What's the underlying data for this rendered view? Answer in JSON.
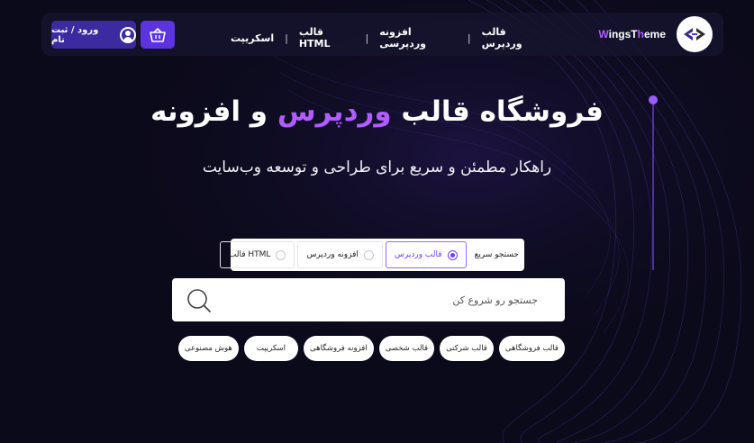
{
  "colors": {
    "background": "#0b0a1a",
    "accent": "#b05cff",
    "button_primary": "#5b34e0",
    "button_secondary": "#3b2aa0"
  },
  "header": {
    "logo_prefix": "W",
    "logo_rest": "ingsT",
    "logo_accent2": "h",
    "logo_suffix": "eme",
    "nav": [
      {
        "label": "قالب وردپرس"
      },
      {
        "label": "افزونه وردپرسی"
      },
      {
        "label": "قالب HTML"
      },
      {
        "label": "اسکریپت"
      }
    ],
    "cart_icon": "basket-icon",
    "login_label": "ورود / ثبت نام",
    "login_icon": "user-circle-icon"
  },
  "hero": {
    "title_part1": "فروشگاه قالب",
    "title_highlight": "وردپرس",
    "title_part2": "و افزونه",
    "subtitle": "راهکار مطمئن و سریع برای طراحی و توسعه وب‌سایت"
  },
  "search": {
    "tabs_label": "جستجو سریع",
    "tabs": [
      {
        "label": "قالب وردپرس",
        "selected": true
      },
      {
        "label": "افزونه وردپرس",
        "selected": false
      },
      {
        "label": "قالب HTML",
        "selected": false
      }
    ],
    "placeholder": "جستجو رو شروع کن",
    "value": "",
    "search_icon": "search-icon"
  },
  "chips": [
    "قالب فروشگاهی",
    "قالب شرکتی",
    "قالب شخصی",
    "افزونه فروشگاهی",
    "اسکریپت",
    "هوش مصنوعی"
  ]
}
